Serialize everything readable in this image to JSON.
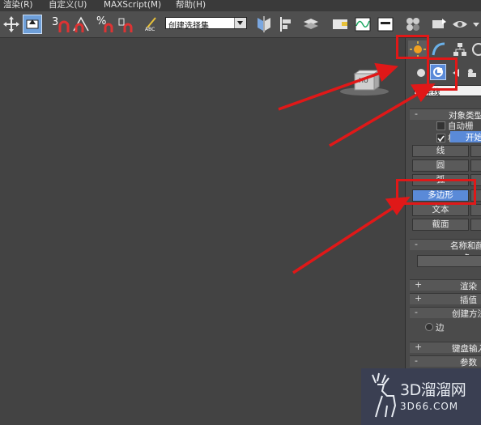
{
  "menu": [
    "渲染(R)",
    "自定义(U)",
    "MAXScript(M)",
    "帮助(H)"
  ],
  "toolbar": {
    "snap_labels": [
      "3",
      "%"
    ],
    "selection_set_placeholder": "创建选择集",
    "abc_label": "ABC"
  },
  "viewport": {
    "cube_label": "HU"
  },
  "command_panel": {
    "object_category_value": "样条线",
    "rollouts": {
      "object_type": "对象类型",
      "auto_grid": "自动栅格",
      "start_new_shape": "开始",
      "name_color": "名称和颜色",
      "rendering": "渲染",
      "interpolation": "插值",
      "creation_method": "创建方法",
      "edge_option": "边",
      "keyboard_entry": "键盘输入",
      "parameters": "参数"
    },
    "shape_buttons": [
      {
        "label": "线",
        "selected": false
      },
      {
        "label": "圆",
        "selected": false
      },
      {
        "label": "弧",
        "selected": false
      },
      {
        "label": "多边形",
        "selected": true
      },
      {
        "label": "文本",
        "selected": false
      },
      {
        "label": "截面",
        "selected": false
      }
    ],
    "collapse_signs": {
      "minus": "-",
      "plus": "+"
    }
  },
  "watermark": {
    "title": "3D溜溜网",
    "subtitle": "3D66.COM"
  },
  "colors": {
    "annotation_red": "#e01818",
    "selected_blue": "#5a8ad8",
    "toolbar_bg": "#4f4f4f",
    "viewport_bg": "#434343"
  }
}
